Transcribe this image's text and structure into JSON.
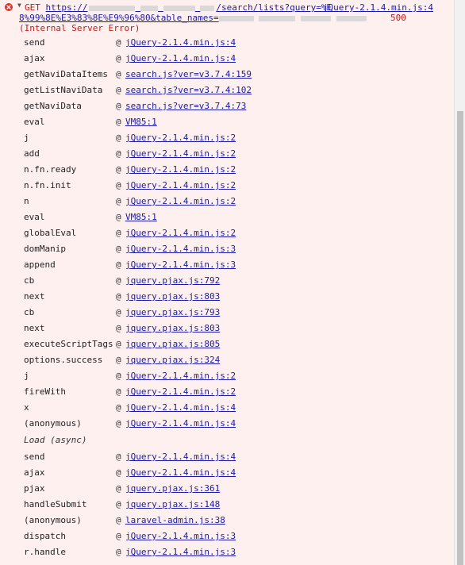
{
  "error": {
    "method": "GET",
    "url_prefix": "https://",
    "url_path": "/search/lists?query=%E",
    "url_line2_start": "8%99%8E%E3%83%8E%E9%96%80&table_names=",
    "initiator": "jQuery-2.1.4.min.js:4",
    "status_code": "500",
    "status_text": "(Internal Server Error)",
    "colors": {
      "error": "#c41a16",
      "link": "#1a1aa6",
      "background": "#fff0f0"
    }
  },
  "stack": [
    {
      "fn": "send",
      "src": "jQuery-2.1.4.min.js:4"
    },
    {
      "fn": "ajax",
      "src": "jQuery-2.1.4.min.js:4"
    },
    {
      "fn": "getNaviDataItems",
      "src": "search.js?ver=v3.7.4:159"
    },
    {
      "fn": "getListNaviData",
      "src": "search.js?ver=v3.7.4:102"
    },
    {
      "fn": "getNaviData",
      "src": "search.js?ver=v3.7.4:73"
    },
    {
      "fn": "eval",
      "src": "VM85:1"
    },
    {
      "fn": "j",
      "src": "jQuery-2.1.4.min.js:2"
    },
    {
      "fn": "add",
      "src": "jQuery-2.1.4.min.js:2"
    },
    {
      "fn": "n.fn.ready",
      "src": "jQuery-2.1.4.min.js:2"
    },
    {
      "fn": "n.fn.init",
      "src": "jQuery-2.1.4.min.js:2"
    },
    {
      "fn": "n",
      "src": "jQuery-2.1.4.min.js:2"
    },
    {
      "fn": "eval",
      "src": "VM85:1"
    },
    {
      "fn": "globalEval",
      "src": "jQuery-2.1.4.min.js:2"
    },
    {
      "fn": "domManip",
      "src": "jQuery-2.1.4.min.js:3"
    },
    {
      "fn": "append",
      "src": "jQuery-2.1.4.min.js:3"
    },
    {
      "fn": "cb",
      "src": "jquery.pjax.js:792"
    },
    {
      "fn": "next",
      "src": "jquery.pjax.js:803"
    },
    {
      "fn": "cb",
      "src": "jquery.pjax.js:793"
    },
    {
      "fn": "next",
      "src": "jquery.pjax.js:803"
    },
    {
      "fn": "executeScriptTags",
      "src": "jquery.pjax.js:805"
    },
    {
      "fn": "options.success",
      "src": "jquery.pjax.js:324"
    },
    {
      "fn": "j",
      "src": "jQuery-2.1.4.min.js:2"
    },
    {
      "fn": "fireWith",
      "src": "jQuery-2.1.4.min.js:2"
    },
    {
      "fn": "x",
      "src": "jQuery-2.1.4.min.js:4"
    },
    {
      "fn": "(anonymous)",
      "src": "jQuery-2.1.4.min.js:4"
    }
  ],
  "async_label": "Load (async)",
  "async_stack": [
    {
      "fn": "send",
      "src": "jQuery-2.1.4.min.js:4"
    },
    {
      "fn": "ajax",
      "src": "jQuery-2.1.4.min.js:4"
    },
    {
      "fn": "pjax",
      "src": "jquery.pjax.js:361"
    },
    {
      "fn": "handleSubmit",
      "src": "jquery.pjax.js:148"
    },
    {
      "fn": "(anonymous)",
      "src": "laravel-admin.js:38"
    },
    {
      "fn": "dispatch",
      "src": "jQuery-2.1.4.min.js:3"
    },
    {
      "fn": "r.handle",
      "src": "jQuery-2.1.4.min.js:3"
    }
  ],
  "at_symbol": "@"
}
